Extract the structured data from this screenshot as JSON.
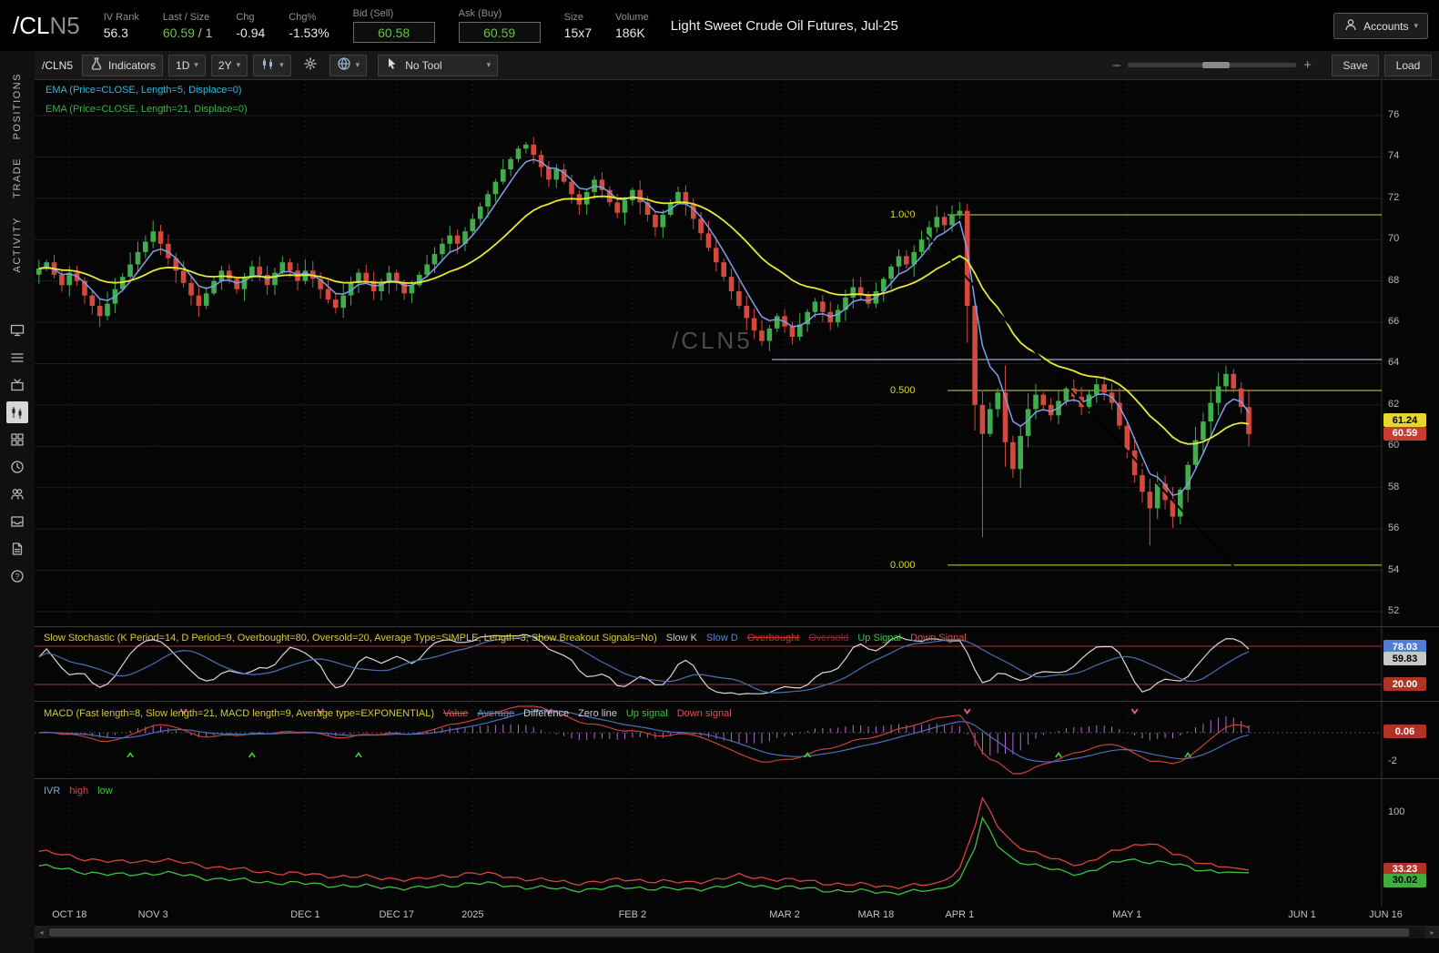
{
  "header": {
    "symbol": "/CL",
    "symbol_month": "N5",
    "iv_rank": {
      "label": "IV Rank",
      "value": "56.3"
    },
    "last_size": {
      "label": "Last / Size",
      "last": "60.59",
      "size": "/ 1"
    },
    "chg": {
      "label": "Chg",
      "value": "-0.94"
    },
    "chg_pct": {
      "label": "Chg%",
      "value": "-1.53%"
    },
    "bid": {
      "label": "Bid (Sell)",
      "value": "60.58"
    },
    "ask": {
      "label": "Ask (Buy)",
      "value": "60.59"
    },
    "size": {
      "label": "Size",
      "value": "15x7"
    },
    "volume": {
      "label": "Volume",
      "value": "186K"
    },
    "description": "Light Sweet Crude Oil Futures, Jul-25",
    "accounts": "Accounts"
  },
  "sidebar": {
    "tabs": [
      {
        "label": "POSITIONS"
      },
      {
        "label": "TRADE"
      },
      {
        "label": "ACTIVITY"
      }
    ],
    "icons": [
      "monitor",
      "list",
      "tv",
      "chart",
      "grid",
      "clock",
      "people",
      "inbox",
      "page",
      "help"
    ],
    "active_icon": "chart"
  },
  "toolbar": {
    "symbol": "/CLN5",
    "indicators": "Indicators",
    "timeframe": "1D",
    "range": "2Y",
    "tool": "No Tool",
    "save": "Save",
    "load": "Load",
    "zoom_minus": "–",
    "zoom_plus": "+"
  },
  "studies": {
    "ema1": {
      "text": "EMA (Price=CLOSE, Length=5, Displace=0)",
      "color": "#2fb6d8"
    },
    "ema2": {
      "text": "EMA (Price=CLOSE, Length=21, Displace=0)",
      "color": "#3fae4a"
    },
    "stoch": {
      "title": "Slow Stochastic (K Period=14, D Period=9, Overbought=80, Oversold=20, Average Type=SIMPLE, Length=3, Show Breakout Signals=No)",
      "title_color": "#d8c93a",
      "legend": [
        {
          "text": "Slow K",
          "color": "#c8c8c8",
          "struck": false
        },
        {
          "text": "Slow D",
          "color": "#5f82cc",
          "struck": false
        },
        {
          "text": "Overbought",
          "color": "#c0392b",
          "struck": true
        },
        {
          "text": "Oversold",
          "color": "#8a2b25",
          "struck": true
        },
        {
          "text": "Up Signal",
          "color": "#3fc13f",
          "struck": false
        },
        {
          "text": "Down Signal",
          "color": "#d9534f",
          "struck": false
        }
      ]
    },
    "macd": {
      "title": "MACD (Fast length=8, Slow length=21, MACD length=9, Average type=EXPONENTIAL)",
      "title_color": "#d8c93a",
      "legend": [
        {
          "text": "Value",
          "color": "#d9534f",
          "struck": true
        },
        {
          "text": "Average",
          "color": "#5f82cc",
          "struck": true
        },
        {
          "text": "Difference",
          "color": "#cfcfcf",
          "struck": false
        },
        {
          "text": "Zero line",
          "color": "#cfcfcf",
          "struck": false
        },
        {
          "text": "Up signal",
          "color": "#3fc13f",
          "struck": false
        },
        {
          "text": "Down signal",
          "color": "#d9534f",
          "struck": false
        }
      ]
    },
    "ivr": {
      "title": "IVR",
      "title_color": "#7ba7d7",
      "legend": [
        {
          "text": "high",
          "color": "#d9443c",
          "struck": false
        },
        {
          "text": "low",
          "color": "#3fc13f",
          "struck": false
        }
      ]
    }
  },
  "chart_data": {
    "type": "candlestick-multi-panel",
    "symbol": "/CLN5",
    "watermark": "/CLN5",
    "price_axis": {
      "min": 52,
      "max": 76,
      "step": 2,
      "badges": [
        {
          "value": "61.24",
          "bg": "#e8d432",
          "fg": "#000000"
        },
        {
          "value": "60.59",
          "bg": "#cc3b30",
          "fg": "#ffffff"
        }
      ]
    },
    "time_axis": [
      {
        "label": "OCT 18",
        "i": 4
      },
      {
        "label": "NOV 3",
        "i": 15
      },
      {
        "label": "DEC 1",
        "i": 35
      },
      {
        "label": "DEC 17",
        "i": 47
      },
      {
        "label": "2025",
        "i": 57
      },
      {
        "label": "FEB 2",
        "i": 78
      },
      {
        "label": "MAR 2",
        "i": 98
      },
      {
        "label": "MAR 18",
        "i": 110
      },
      {
        "label": "APR 1",
        "i": 121
      },
      {
        "label": "MAY 1",
        "i": 143
      },
      {
        "label": "JUN 1",
        "i": 166
      },
      {
        "label": "JUN 16",
        "i": 177
      }
    ],
    "first_open": 68.3,
    "closes": [
      68.6,
      68.9,
      68.3,
      67.8,
      68.4,
      68.0,
      67.3,
      66.8,
      66.3,
      66.9,
      67.6,
      68.2,
      68.8,
      69.4,
      69.9,
      70.4,
      69.8,
      69.1,
      68.5,
      67.9,
      67.3,
      66.8,
      67.4,
      68.0,
      68.5,
      68.1,
      67.6,
      68.2,
      68.7,
      68.3,
      67.8,
      68.4,
      68.9,
      68.5,
      68.0,
      68.5,
      68.1,
      67.6,
      67.1,
      66.7,
      67.3,
      67.9,
      68.4,
      68.0,
      67.5,
      67.9,
      68.4,
      67.9,
      67.4,
      67.8,
      68.3,
      68.8,
      69.3,
      69.8,
      70.2,
      69.8,
      70.4,
      71.0,
      71.6,
      72.2,
      72.8,
      73.4,
      73.9,
      74.4,
      74.6,
      74.1,
      73.5,
      72.9,
      73.4,
      72.8,
      72.2,
      71.7,
      72.3,
      72.9,
      72.4,
      71.8,
      71.3,
      71.9,
      72.4,
      71.8,
      71.2,
      70.6,
      71.2,
      71.8,
      72.3,
      71.7,
      71.0,
      70.3,
      69.6,
      68.9,
      68.2,
      67.5,
      66.8,
      66.2,
      65.6,
      65.1,
      65.7,
      66.3,
      65.8,
      65.3,
      65.9,
      66.5,
      67.0,
      66.5,
      66.0,
      66.6,
      67.2,
      67.7,
      67.3,
      66.9,
      67.5,
      68.1,
      68.7,
      69.2,
      68.8,
      69.4,
      70.0,
      70.6,
      71.1,
      70.7,
      71.2,
      71.4,
      66.8,
      62.0,
      60.6,
      61.8,
      62.6,
      60.2,
      58.9,
      60.5,
      61.8,
      62.5,
      62.0,
      61.5,
      62.2,
      62.8,
      62.4,
      61.9,
      62.5,
      63.0,
      62.6,
      62.1,
      61.0,
      59.8,
      58.6,
      57.8,
      57.0,
      58.2,
      57.4,
      56.6,
      57.9,
      59.1,
      60.3,
      61.2,
      62.1,
      62.9,
      63.5,
      62.8,
      61.9,
      60.59
    ],
    "wick_overrides": {
      "124": {
        "low": 55.6
      },
      "146": {
        "low": 55.2
      },
      "156": {
        "high": 63.9
      }
    },
    "fib_levels": [
      {
        "label": "1.000",
        "price": 71.2
      },
      {
        "label": "0.500",
        "price": 62.7
      },
      {
        "label": "0.000",
        "price": 54.25
      }
    ],
    "horizontal_line_price": 64.2,
    "trendline": {
      "x1_i": 113,
      "p1": 71.7,
      "x2_i": 157,
      "p2": 54.2
    },
    "stoch_levels": {
      "overbought": 80,
      "oversold": 20
    },
    "stoch_badges": [
      {
        "value": "78.03",
        "bg": "#4f7bd9",
        "fg": "#ffffff"
      },
      {
        "value": "59.83",
        "bg": "#c8c8c8",
        "fg": "#000000"
      },
      {
        "value": "20.00",
        "bg": "#b03328",
        "fg": "#ffffff"
      }
    ],
    "macd_badge": {
      "value": "0.06",
      "bg": "#b03328",
      "fg": "#ffffff"
    },
    "macd_axis_label": "-2",
    "ivr_axis_label": "100",
    "ivr_badges": [
      {
        "value": "33.23",
        "bg": "#b03328",
        "fg": "#ffffff"
      },
      {
        "value": "30.02",
        "bg": "#3fae3f",
        "fg": "#000000"
      }
    ],
    "ivr_red_keypoints": [
      [
        0,
        55
      ],
      [
        5,
        48
      ],
      [
        10,
        42
      ],
      [
        16,
        45
      ],
      [
        22,
        38
      ],
      [
        28,
        32
      ],
      [
        35,
        28
      ],
      [
        42,
        25
      ],
      [
        50,
        22
      ],
      [
        57,
        30
      ],
      [
        63,
        24
      ],
      [
        70,
        18
      ],
      [
        78,
        22
      ],
      [
        85,
        18
      ],
      [
        92,
        26
      ],
      [
        98,
        22
      ],
      [
        105,
        17
      ],
      [
        112,
        14
      ],
      [
        118,
        16
      ],
      [
        121,
        35
      ],
      [
        123,
        85
      ],
      [
        124,
        115
      ],
      [
        126,
        85
      ],
      [
        128,
        65
      ],
      [
        131,
        52
      ],
      [
        134,
        44
      ],
      [
        137,
        40
      ],
      [
        140,
        50
      ],
      [
        143,
        60
      ],
      [
        146,
        66
      ],
      [
        149,
        52
      ],
      [
        152,
        44
      ],
      [
        155,
        38
      ],
      [
        159,
        33.2
      ]
    ],
    "ivr_green_keypoints": [
      [
        0,
        38
      ],
      [
        5,
        32
      ],
      [
        10,
        27
      ],
      [
        16,
        30
      ],
      [
        22,
        24
      ],
      [
        28,
        20
      ],
      [
        35,
        17
      ],
      [
        42,
        14
      ],
      [
        50,
        12
      ],
      [
        57,
        18
      ],
      [
        63,
        14
      ],
      [
        70,
        10
      ],
      [
        78,
        13
      ],
      [
        85,
        10
      ],
      [
        92,
        16
      ],
      [
        98,
        13
      ],
      [
        105,
        9
      ],
      [
        112,
        7
      ],
      [
        118,
        9
      ],
      [
        121,
        22
      ],
      [
        123,
        60
      ],
      [
        124,
        92
      ],
      [
        126,
        62
      ],
      [
        128,
        46
      ],
      [
        131,
        38
      ],
      [
        134,
        32
      ],
      [
        137,
        29
      ],
      [
        140,
        37
      ],
      [
        143,
        46
      ],
      [
        149,
        40
      ],
      [
        152,
        35
      ],
      [
        155,
        31
      ],
      [
        159,
        30.0
      ]
    ],
    "colors": {
      "up": "#3fae4a",
      "down": "#d24a3e",
      "ema_fast_line": "#7f9fe8",
      "ema_slow_line": "#e8e832",
      "fib": "#d8d832",
      "level_line": "#7d93a6",
      "trendline": "#000000",
      "grid": "#1d1d1d",
      "vgrid": "#242424",
      "watermark": "#4a4a4a",
      "stoch_k": "#d8d8d8",
      "stoch_d": "#4a6fb5",
      "stoch_band": "#a03830",
      "macd_value": "#cc4036",
      "macd_avg": "#4a6fb5",
      "macd_hist": "#b06ad0",
      "up_signal": "#3fc13f",
      "down_signal": "#e0609a",
      "ivr_high": "#d9443c",
      "ivr_low": "#3fc13f"
    }
  }
}
